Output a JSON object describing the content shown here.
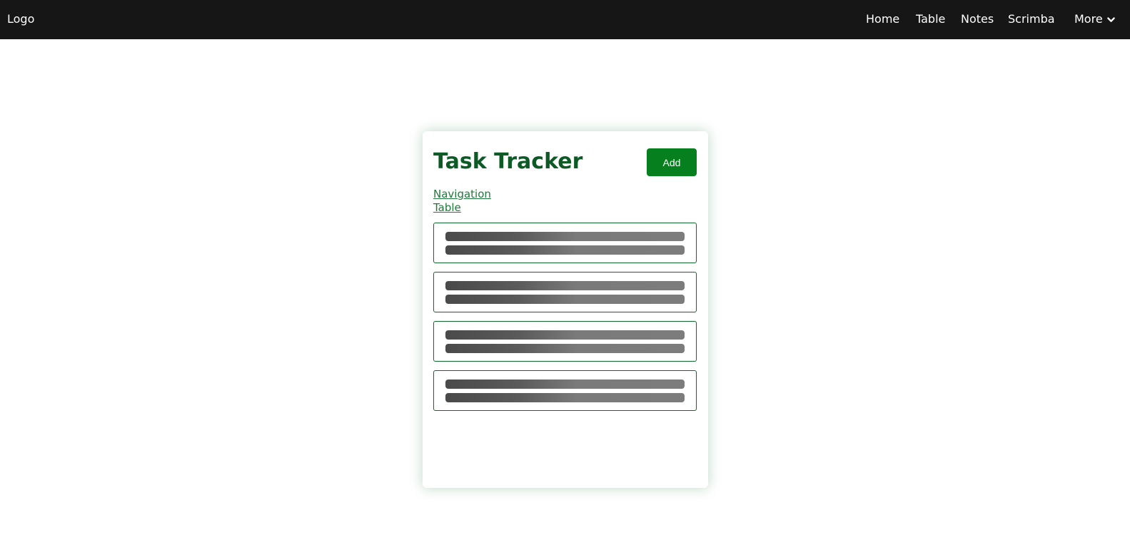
{
  "header": {
    "logo": "Logo",
    "nav": {
      "home": "Home",
      "table": "Table",
      "notes": "Notes",
      "scrimba": "Scrimba",
      "more": "More"
    }
  },
  "card": {
    "title": "Task Tracker",
    "add_label": "Add",
    "links": {
      "navigation": "Navigation",
      "table": "Table"
    },
    "loading_items": 4
  },
  "colors": {
    "nav_background": "#161616",
    "title_green": "#0d5a26",
    "button_green": "#06801f",
    "link_green": "#1f7a3a",
    "border_green": "#0e6a2c",
    "skeleton_dark": "#4a4a4a",
    "skeleton_light": "#7c7c7c"
  },
  "icons": {
    "more_dropdown": "chevron-down-icon"
  }
}
